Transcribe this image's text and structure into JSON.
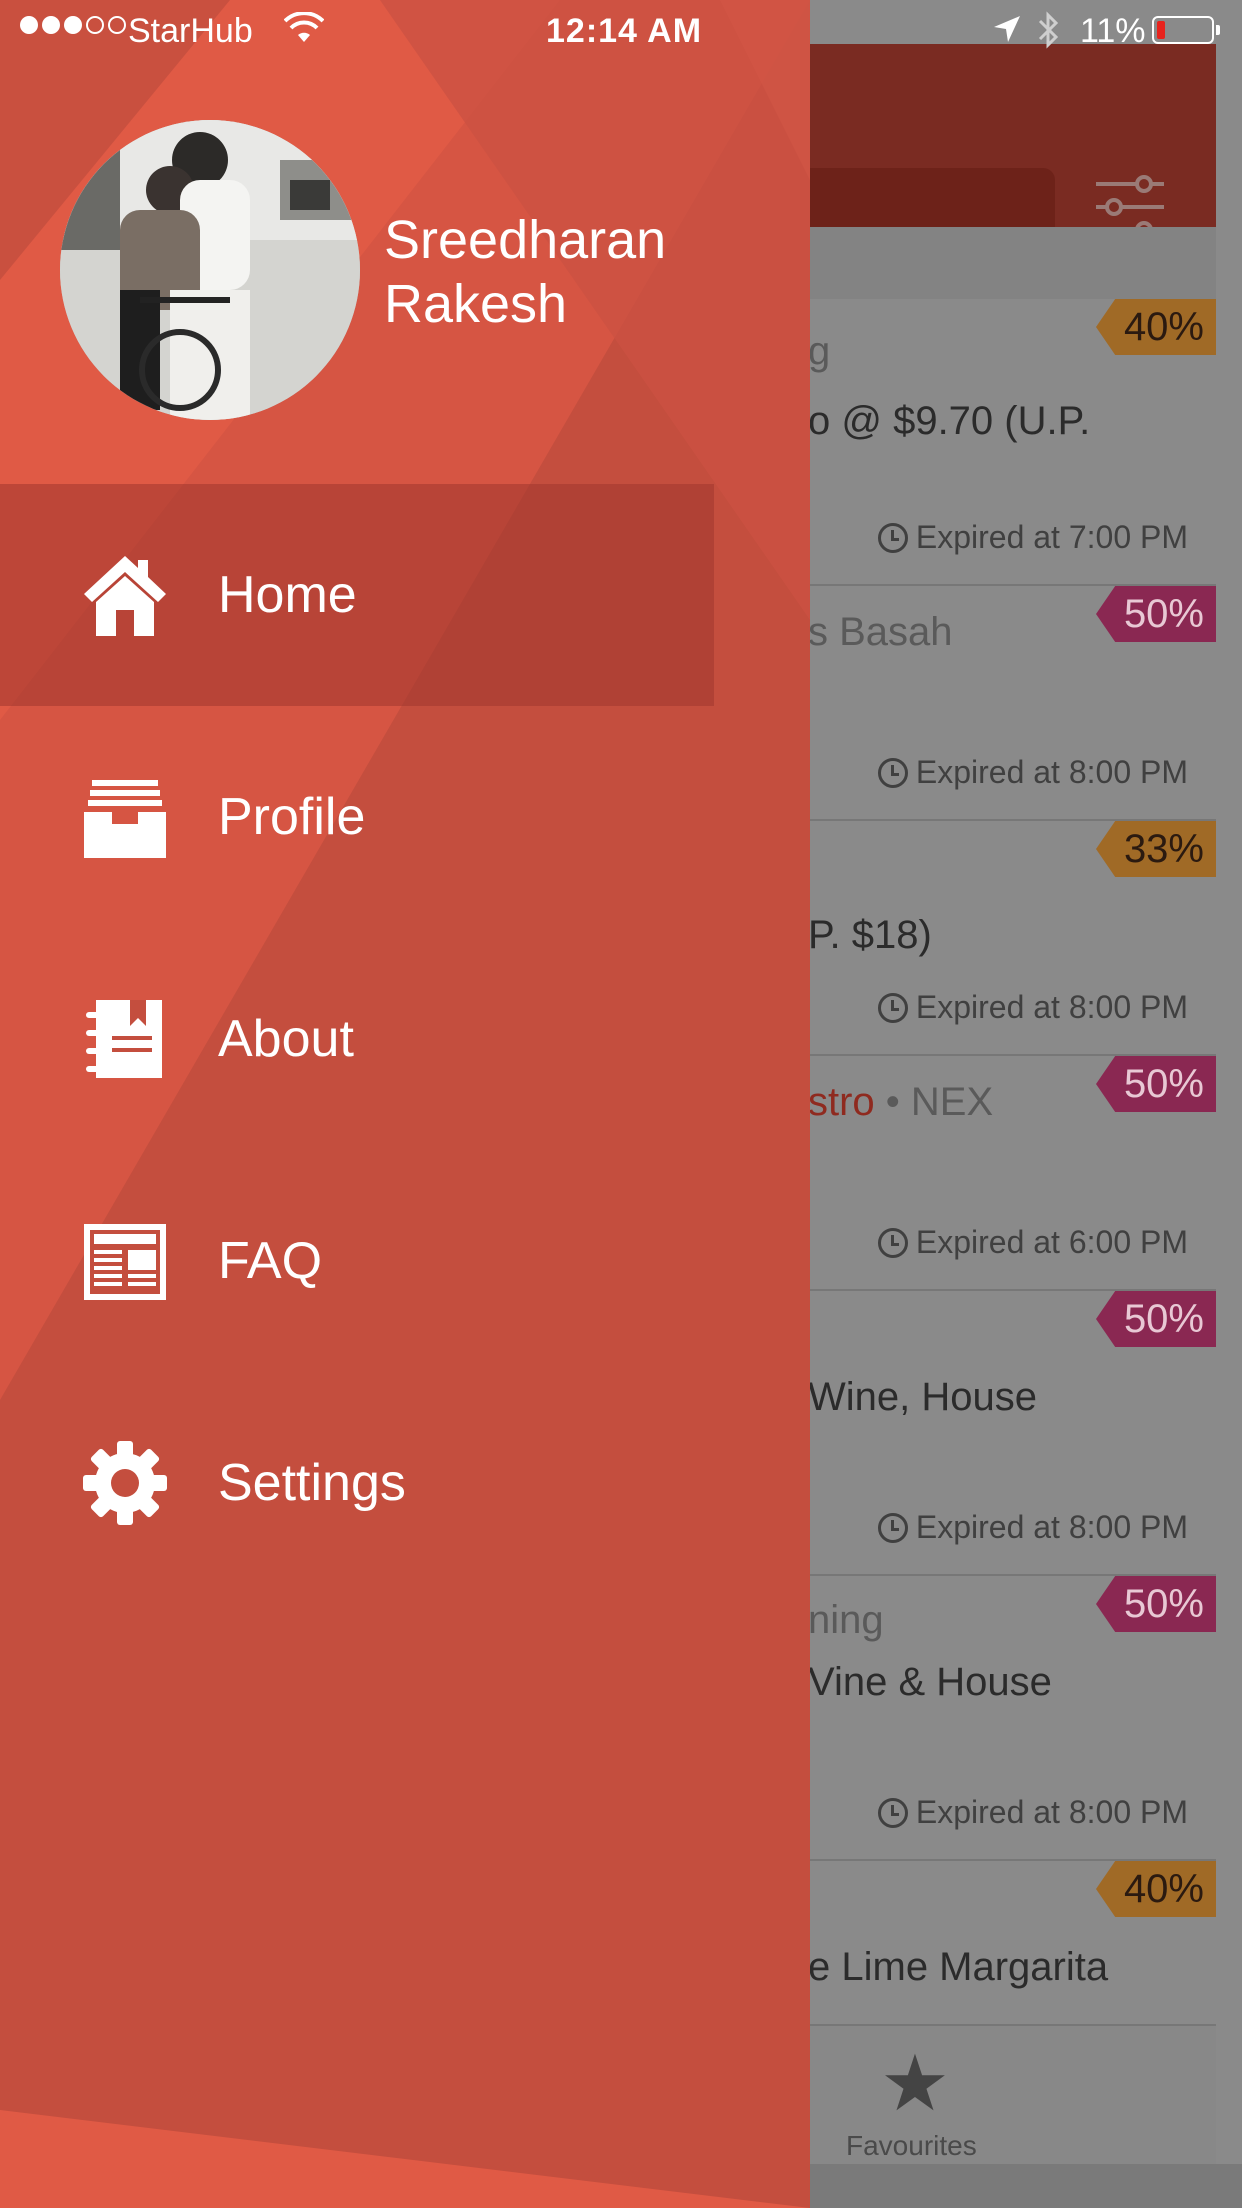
{
  "status_bar": {
    "carrier": "StarHub",
    "time": "12:14 AM",
    "battery": "11%"
  },
  "user": {
    "first_name": "Sreedharan",
    "last_name": "Rakesh"
  },
  "menu": [
    {
      "label": "Home",
      "icon": "home-icon",
      "active": true
    },
    {
      "label": "Profile",
      "icon": "inbox-tray-icon",
      "active": false
    },
    {
      "label": "About",
      "icon": "notebook-icon",
      "active": false
    },
    {
      "label": "FAQ",
      "icon": "newspaper-icon",
      "active": false
    },
    {
      "label": "Settings",
      "icon": "gear-icon",
      "active": false
    }
  ],
  "background_deals": [
    {
      "line1": "g",
      "line2": "o @ $9.70 (U.P.",
      "expiry": "Expired at 7:00 PM",
      "discount": "40%",
      "badge_color": "#a06a26"
    },
    {
      "line1": "s Basah",
      "line2": "",
      "expiry": "Expired at 8:00 PM",
      "discount": "50%",
      "badge_color": "#8a2852"
    },
    {
      "line1": "",
      "line2": "P. $18)",
      "expiry": "Expired at 8:00 PM",
      "discount": "33%",
      "badge_color": "#a06a26"
    },
    {
      "line1_accent": "stro",
      "line1_rest": " • NEX",
      "line2": "",
      "expiry": "Expired at 6:00 PM",
      "discount": "50%",
      "badge_color": "#8a2852"
    },
    {
      "line1": "",
      "line2": " Wine, House",
      "expiry": "Expired at 8:00 PM",
      "discount": "50%",
      "badge_color": "#8a2852"
    },
    {
      "line1": "ning",
      "line2": "Vine & House",
      "expiry": "Expired at 8:00 PM",
      "discount": "50%",
      "badge_color": "#8a2852"
    },
    {
      "line1": "",
      "line2": "e Lime Margarita",
      "expiry": "",
      "discount": "40%",
      "badge_color": "#a06a26"
    }
  ],
  "tabbar": {
    "favourites_label": "Favourites"
  },
  "colors": {
    "drawer": "#c44e3e",
    "drawer_light": "#e05a45",
    "header": "#7a2b22"
  }
}
